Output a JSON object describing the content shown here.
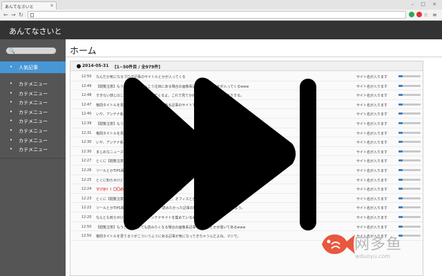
{
  "browser": {
    "tab_title": "あんてなさいと",
    "tab_close": "×",
    "window_controls": "– □ ×",
    "nav_icons": [
      "back-arrow-icon",
      "forward-arrow-icon",
      "reload-icon"
    ],
    "extension_colors": [
      "#2fa84f",
      "#d33"
    ]
  },
  "app": {
    "title": "あんてなさいと"
  },
  "sidebar": {
    "search_icon": "🔍",
    "popular": {
      "bullet": "•",
      "label": "人気記事"
    },
    "menu_items": [
      {
        "bullet": "•",
        "label": "カテメニュー"
      },
      {
        "bullet": "•",
        "label": "カテメニュー"
      },
      {
        "bullet": "•",
        "label": "カテメニュー"
      },
      {
        "bullet": "•",
        "label": "カテメニュー"
      },
      {
        "bullet": "•",
        "label": "カテメニュー"
      },
      {
        "bullet": "•",
        "label": "カテメニュー"
      },
      {
        "bullet": "•",
        "label": "カテメニュー"
      },
      {
        "bullet": "•",
        "label": "カテメニュー"
      }
    ]
  },
  "main": {
    "page_title": "ホーム",
    "panel": {
      "date": "2014-05-31",
      "count": "[1~50件目 / 全979件]"
    },
    "rows": [
      {
        "time": "12:50",
        "title": "なんだか気になるブログ記事のサイトルとかが入ってくる",
        "site": "サイト名が入ります",
        "highlight": false
      },
      {
        "time": "12:49",
        "title": "【閲覧注意】もうどう見てもけっこう注目にある場合の画像系記事サイトルとかが入ってくるwww",
        "site": "サイト名が入ります",
        "highlight": false
      },
      {
        "time": "12:48",
        "title": "すきない感じのニュースサイトが入ってくるよ。これで見てかわいくなりそうですわりりする。",
        "site": "サイト名が入ります",
        "highlight": false
      },
      {
        "time": "12:47",
        "title": "格問タイトルを見てるツが入ってくるようにある記事のサイトです",
        "site": "サイト名が入ります",
        "highlight": false
      },
      {
        "time": "12:40",
        "title": "いや、アンテナ系サイトもたくさんあるわけだよ",
        "site": "サイト名が入ります",
        "highlight": false
      },
      {
        "time": "12:39",
        "title": "【閲覧注意】もうどう見てもけっこう注目にある場合の",
        "site": "サイト名が入ります",
        "highlight": false
      },
      {
        "time": "12:31",
        "title": "格問タイトルを見てるツが入ってくる",
        "site": "サイト名が入ります",
        "highlight": false
      },
      {
        "time": "12:30",
        "title": "いや、アンテナ系サイトもたくさん",
        "site": "サイト名が入ります",
        "highlight": false
      },
      {
        "time": "12:30",
        "title": "まじめなニュースとかが入ってくる",
        "site": "サイト名が入ります",
        "highlight": false
      },
      {
        "time": "12:27",
        "title": "とくに【閲覧注意】とかのタイトル",
        "site": "サイト名が入ります",
        "highlight": false
      },
      {
        "time": "12:26",
        "title": "ツールとかTIPS系の記事もはいる",
        "site": "サイト名が入ります",
        "highlight": false
      },
      {
        "time": "12:25",
        "title": "とくに知らせけど、作者は例",
        "site": "サイト名が入ります",
        "highlight": false
      },
      {
        "time": "12:24",
        "title": "マジか！！〇〇の画像がwwwwwwwwwwwwwww",
        "site": "サイト名が入ります",
        "highlight": true
      },
      {
        "time": "12:23",
        "title": "とくに【閲覧注意】とかのタイトルでもないけど、オフィスとか母親を見てたら絶対にやまだー",
        "site": "サイト名が入ります",
        "highlight": false
      },
      {
        "time": "12:22",
        "title": "ツールとかTIPS系の記事もはいるんだよ。読みたかった記事の間に並ぶ感じで表示してみよう。",
        "site": "サイト名が入ります",
        "highlight": false
      },
      {
        "time": "12:20",
        "title": "なんとも知らせけど、作者は特にアンテナサイトを集めているのではないのだよ。",
        "site": "サイト名が入ります",
        "highlight": false
      },
      {
        "time": "12:50",
        "title": "【閲覧注意】もうどうあれいても読みたくなる場合の画像系記事タイトルとかが書いてあるwww",
        "site": "サイト名が入ります",
        "highlight": false
      },
      {
        "time": "12:50",
        "title": "格問タイトルを見てるツがこういうふうにある記事が気になってきちゃうんだよね。マジで。",
        "site": "サイト名が入ります",
        "highlight": false
      }
    ],
    "bar_fraction": 0.2
  },
  "overlay": {
    "icon": "fast-forward-icon"
  },
  "watermark": {
    "text": "网多鱼",
    "url": "wduoyu.com",
    "fish_color": "#e9573f"
  }
}
